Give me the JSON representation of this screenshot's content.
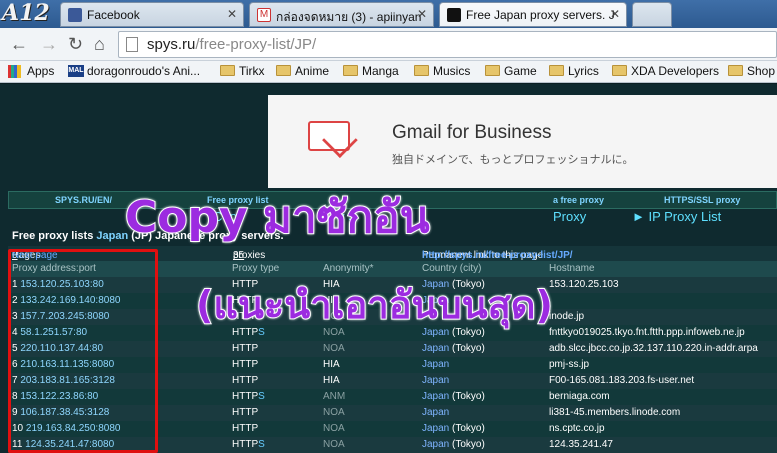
{
  "browser": {
    "tabs": [
      {
        "label": "Facebook",
        "icon": "facebook-icon"
      },
      {
        "label": "กล่องจดหมาย (3) - apiinyan",
        "icon": "gmail-icon"
      },
      {
        "label": "Free Japan proxy servers. J",
        "icon": "spys-icon"
      }
    ],
    "logo": "A12",
    "url_domain": "spys.ru",
    "url_path": "/free-proxy-list/JP/",
    "bookmarks": [
      "Apps",
      "doragonroudo's Ani...",
      "Tirkx",
      "Anime",
      "Manga",
      "Musics",
      "Game",
      "Lyrics",
      "XDA Developers",
      "Shop"
    ]
  },
  "ad": {
    "title": "Gmail for Business",
    "subtitle": "独自ドメインで、もっとプロフェッショナルに。"
  },
  "site_nav": {
    "top": [
      "SPYS.RU/EN/",
      "Free proxy list",
      "a free proxy",
      "HTTPS/SSL proxy"
    ],
    "links": [
      "Copy",
      "y S",
      "Proxy",
      "► IP Proxy List"
    ]
  },
  "list": {
    "heading": "Free proxy lists",
    "country": "Japan",
    "heading_rest": "(JP) Japanese proxy servers.",
    "pages_label": "Pages",
    "pages_current": "0",
    "next_page": "Next page",
    "proxies_count": "35",
    "proxies_label": "proxies",
    "permalink_label": "Permanent link to this page:",
    "permalink_url": "http://spys.ru/free-proxy-list/JP/",
    "columns": [
      "Proxy address:port",
      "Proxy type",
      "Anonymity*",
      "Country (city)",
      "Hostname"
    ],
    "rows": [
      {
        "n": "1",
        "ip": "153.120.25.103",
        "port": "80",
        "type": "HTTP",
        "anon": "HIA",
        "country": "Japan",
        "city": "(Tokyo)",
        "host": "153.120.25.103"
      },
      {
        "n": "2",
        "ip": "133.242.169.140",
        "port": "8080",
        "type": "HTTP",
        "anon": "HIA",
        "country": "Japan",
        "city": "",
        "host": ""
      },
      {
        "n": "3",
        "ip": "157.7.203.245",
        "port": "8080",
        "type": "HTTP",
        "anon": "NOA",
        "country": "",
        "city": "",
        "host": "inode.jp"
      },
      {
        "n": "4",
        "ip": "58.1.251.57",
        "port": "80",
        "type": "HTTPS",
        "anon": "NOA",
        "country": "Japan",
        "city": "(Tokyo)",
        "host": "fnttkyo019025.tkyo.fnt.ftth.ppp.infoweb.ne.jp"
      },
      {
        "n": "5",
        "ip": "220.110.137.44",
        "port": "80",
        "type": "HTTP",
        "anon": "NOA",
        "country": "Japan",
        "city": "(Tokyo)",
        "host": "adb.slcc.jbcc.co.jp.32.137.110.220.in-addr.arpa"
      },
      {
        "n": "6",
        "ip": "210.163.11.135",
        "port": "8080",
        "type": "HTTP",
        "anon": "HIA",
        "country": "Japan",
        "city": "",
        "host": "pmj-ss.jp"
      },
      {
        "n": "7",
        "ip": "203.183.81.165",
        "port": "3128",
        "type": "HTTP",
        "anon": "HIA",
        "country": "Japan",
        "city": "",
        "host": "F00-165.081.183.203.fs-user.net"
      },
      {
        "n": "8",
        "ip": "153.122.23.86",
        "port": "80",
        "type": "HTTPS",
        "anon": "ANM",
        "country": "Japan",
        "city": "(Tokyo)",
        "host": "berniaga.com"
      },
      {
        "n": "9",
        "ip": "106.187.38.45",
        "port": "3128",
        "type": "HTTP",
        "anon": "NOA",
        "country": "Japan",
        "city": "",
        "host": "li381-45.members.linode.com"
      },
      {
        "n": "10",
        "ip": "219.163.84.250",
        "port": "8080",
        "type": "HTTP",
        "anon": "NOA",
        "country": "Japan",
        "city": "(Tokyo)",
        "host": "ns.cptc.co.jp"
      },
      {
        "n": "11",
        "ip": "124.35.241.47",
        "port": "8080",
        "type": "HTTPS",
        "anon": "NOA",
        "country": "Japan",
        "city": "(Tokyo)",
        "host": "124.35.241.47"
      }
    ]
  },
  "overlay": {
    "line1": "Copy มาซักอัน",
    "line2": "(แนะนำเอาอันบนสุด)",
    "color": "#9c2be0",
    "highlight_color": "#e01010"
  }
}
